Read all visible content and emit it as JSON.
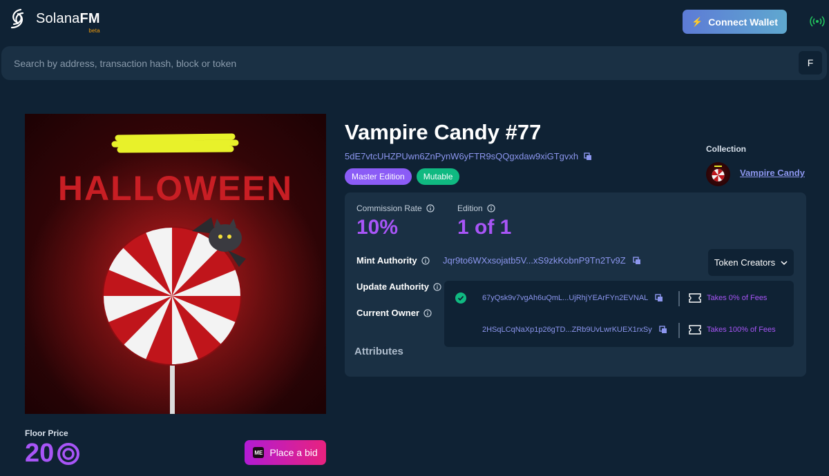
{
  "header": {
    "logo_text_main": "Solana",
    "logo_text_accent": "FM",
    "logo_badge": "beta",
    "connect_label": "Connect Wallet",
    "network_icon": "signal-icon"
  },
  "search": {
    "placeholder": "Search by address, transaction hash, block or token",
    "shortcut_key": "F"
  },
  "nft": {
    "title": "Vampire Candy #77",
    "mint_address": "5dE7vtcUHZPUwn6ZnPynW6yFTR9sQQgxdaw9xiGTgvxh",
    "badges": {
      "edition_type": "Master Edition",
      "mutability": "Mutable"
    },
    "image_text": "HALLOWEEN"
  },
  "collection": {
    "label": "Collection",
    "name": "Vampire Candy"
  },
  "stats": {
    "commission_label": "Commission Rate",
    "commission_value": "10%",
    "edition_label": "Edition",
    "edition_value": "1 of 1"
  },
  "authorities": {
    "mint_label": "Mint Authority",
    "mint_address": "Jqr9to6WXxsojatb5V...xS9zkKobnP9Tn2Tv9Z",
    "update_label": "Update Authority",
    "owner_label": "Current Owner"
  },
  "creators": {
    "button_label": "Token Creators",
    "items": [
      {
        "address": "67yQsk9v7vgAh6uQmL...UjRhjYEArFYn2EVNAL",
        "fee": "Takes 0% of Fees",
        "verified": true
      },
      {
        "address": "2HSqLCqNaXp1p26gTD...ZRb9UvLwrKUEX1rxSy",
        "fee": "Takes 100% of Fees",
        "verified": false
      }
    ]
  },
  "attributes": {
    "label": "Attributes"
  },
  "market": {
    "floor_label": "Floor Price",
    "floor_value": "20",
    "bid_label": "Place a bid",
    "bid_logo_text": "ME"
  },
  "colors": {
    "background": "#0f2234",
    "panel": "#1a3044",
    "accent_purple": "#a855f7",
    "link_blue": "#8c96ee",
    "verified_green": "#10b981"
  }
}
